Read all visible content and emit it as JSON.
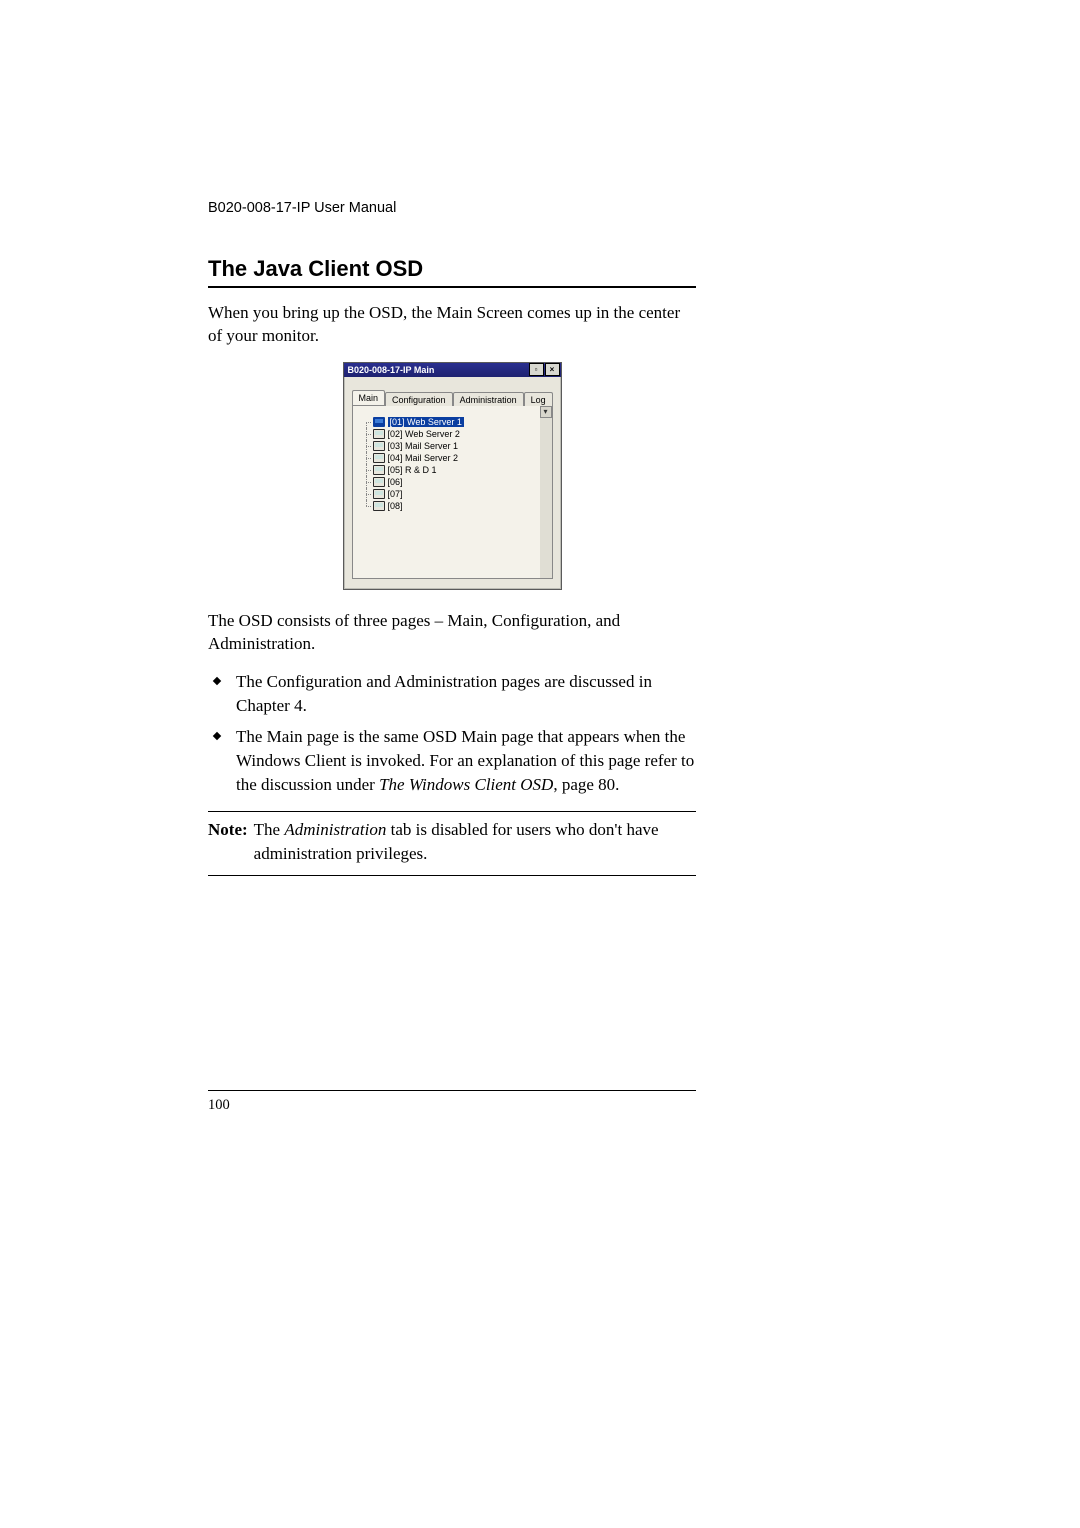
{
  "header": "B020-008-17-IP User Manual",
  "title": "The Java Client OSD",
  "intro": "When you bring up the OSD, the Main Screen comes up in the center of your monitor.",
  "osd": {
    "window_title": "B020-008-17-IP Main",
    "min_glyph": "▫",
    "close_glyph": "×",
    "tabs": {
      "main": "Main",
      "config": "Configuration",
      "admin": "Administration",
      "log": "Log"
    },
    "scroll_glyph": "▾",
    "items": [
      {
        "label": "[01] Web Server 1",
        "selected": true
      },
      {
        "label": "[02] Web Server 2",
        "selected": false
      },
      {
        "label": "[03] Mail Server 1",
        "selected": false
      },
      {
        "label": "[04] Mail Server 2",
        "selected": false
      },
      {
        "label": "[05] R & D 1",
        "selected": false
      },
      {
        "label": "[06]",
        "selected": false
      },
      {
        "label": "[07]",
        "selected": false
      },
      {
        "label": "[08]",
        "selected": false
      }
    ]
  },
  "para_after": "The OSD consists of three pages – Main, Configuration, and Administration.",
  "bullets": {
    "b1": "The Configuration and Administration pages are discussed in Chapter 4.",
    "b2_a": "The Main page is the same OSD Main page that appears when the Windows Client is invoked. For an explanation of this page refer to the discussion under  ",
    "b2_em": "The Windows Client OSD",
    "b2_b": ", page 80."
  },
  "note": {
    "label": "Note:",
    "a": "The ",
    "em": "Administration",
    "b": " tab is disabled for users who don't have administration privileges."
  },
  "page_number": "100"
}
